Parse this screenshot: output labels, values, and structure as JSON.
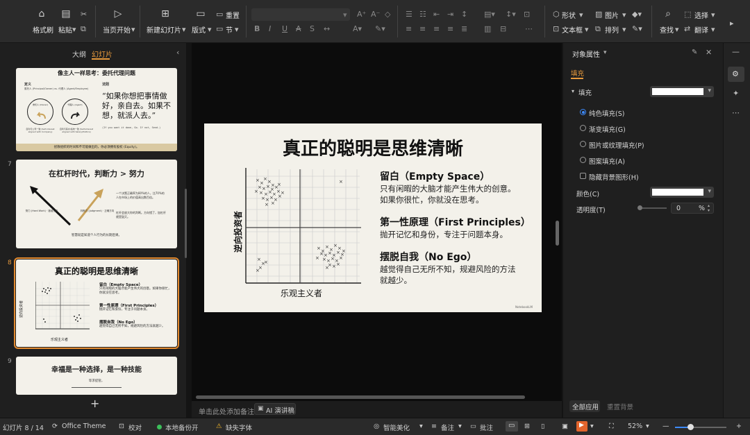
{
  "toolbar": {
    "format_painter": "格式刷",
    "paste": "粘贴",
    "from_current": "当页开始",
    "new_slide": "新建幻灯片",
    "layout": "版式",
    "reset": "重置",
    "section": "节",
    "shape": "形状",
    "picture": "图片",
    "textbox": "文本框",
    "arrange": "排列",
    "find": "查找",
    "select": "选择",
    "translate": "翻译"
  },
  "left_panel": {
    "tab_outline": "大纲",
    "tab_slides": "幻灯片",
    "add_slide": "+",
    "slides": [
      {
        "number": "",
        "title": "像主人一样思考：委托代理问题",
        "definition_label": "定义",
        "rule_label": "法则",
        "definition_text": "委托人 (Principal/Owner) vs. 代理人 (Agent/Employee)",
        "principal_label": "委托人 (Owner)",
        "agent_label": "代理人 (Agent)",
        "principal_desc": "自利与公司一致 (Self-interest aligned with Company)",
        "agent_desc": "自利与薪水/绩效一致 (Self-interest aligned with Salary/Politics)",
        "quote": "“如果你想把事情做好，亲自去。如果不想，就派人去。”",
        "quote_en": "(If you want it done, Go. If not, Send.)",
        "footer": "拯救组织的时间和不可能做出的，你必须拥有股权 (Equity)。"
      },
      {
        "number": "7",
        "title": "在杠杆时代，判断力 > 努力",
        "hard_work": "努力 (Hard Work) · 错误方向",
        "judgment": "判断力 (Judgment) · 正确方向",
        "text1": "一个决策正确率为80%的人，比70%的人在市场上的价值高出数百倍。",
        "text2": "杠杆会放大你的判断。方向错了，加杠杆就是毁灭。",
        "footer": "智慧就是知道个人行为的长期后果。"
      },
      {
        "number": "8",
        "title": "真正的聪明是思维清晰",
        "p1_title": "留白（Empty Space）",
        "p1_text": "只有闲暇的大脑才能产生伟大的创意。如果你很忙，你就没在思考。",
        "p2_title": "第一性原理（First Principles）",
        "p2_text": "抛开记忆和身份，专注于问题本身。",
        "p3_title": "摆脱自我（No Ego）",
        "p3_text": "越觉得自己无所不知，规避风险的方法就越少。",
        "y_label": "逆向投资者",
        "x_label": "乐观主义者"
      },
      {
        "number": "9",
        "title": "幸福是一种选择，是一种技能",
        "subtitle": "等求提管。"
      }
    ]
  },
  "main_slide": {
    "title": "真正的聪明是思维清晰",
    "point1_title": "留白（Empty Space）",
    "point1_line1": "只有闲暇的大脑才能产生伟大的创意。",
    "point1_line2": "如果你很忙，你就没在思考。",
    "point2_title": "第一性原理（First Principles）",
    "point2_line1": "抛开记忆和身份，专注于问题本身。",
    "point3_title": "摆脱自我（No Ego）",
    "point3_line1": "越觉得自己无所不知，规避风险的方法",
    "point3_line2": "就越少。",
    "y_axis_label": "逆向投资者",
    "x_axis_label": "乐观主义者",
    "watermark": "NotebookLM"
  },
  "notes": {
    "placeholder": "单击此处添加备注",
    "ai_button": "AI 演讲稿"
  },
  "right_panel": {
    "title": "对象属性",
    "tab_fill": "填充",
    "section_fill": "填充",
    "options": [
      "纯色填充(S)",
      "渐变填充(G)",
      "图片或纹理填充(P)",
      "图案填充(A)"
    ],
    "hide_bg": "隐藏背景图形(H)",
    "color_label": "颜色(C)",
    "transparency_label": "透明度(T)",
    "transparency_value": "0",
    "percent": "%",
    "apply_all": "全部应用",
    "reset_bg": "重置背景"
  },
  "status": {
    "slide_info": "幻灯片 8 / 14",
    "theme": "Office Theme",
    "proofing": "校对",
    "backup": "本地备份开",
    "missing_font": "缺失字体",
    "beautify": "智能美化",
    "notes": "备注",
    "comments": "批注",
    "zoom": "52%"
  }
}
